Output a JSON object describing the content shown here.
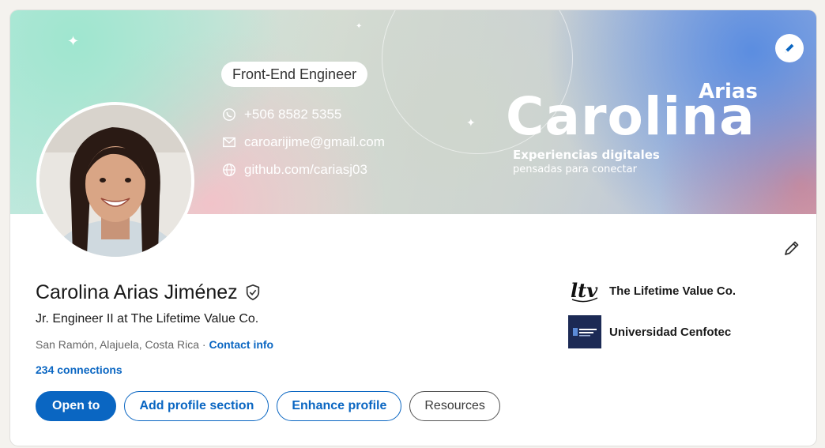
{
  "banner": {
    "role": "Front-End Engineer",
    "phone": "+506 8582 5355",
    "email": "caroarijime@gmail.com",
    "website": "github.com/cariasj03",
    "brand_first": "Carolina",
    "brand_last": "Arias",
    "tagline_1": "Experiencias digitales",
    "tagline_2": "pensadas para conectar"
  },
  "profile": {
    "name": "Carolina Arias Jiménez",
    "headline": "Jr. Engineer II at The Lifetime Value Co.",
    "location": "San Ramón, Alajuela, Costa Rica",
    "separator": "·",
    "contact_info_label": "Contact info",
    "connections": "234 connections"
  },
  "actions": {
    "open_to": "Open to",
    "add_section": "Add profile section",
    "enhance": "Enhance profile",
    "resources": "Resources"
  },
  "organizations": [
    {
      "name": "The Lifetime Value Co.",
      "logo": "ltv-logo-icon"
    },
    {
      "name": "Universidad Cenfotec",
      "logo": "cenfotec-logo-icon"
    }
  ],
  "colors": {
    "accent": "#0a66c2",
    "text": "#191919",
    "muted": "#666666"
  }
}
